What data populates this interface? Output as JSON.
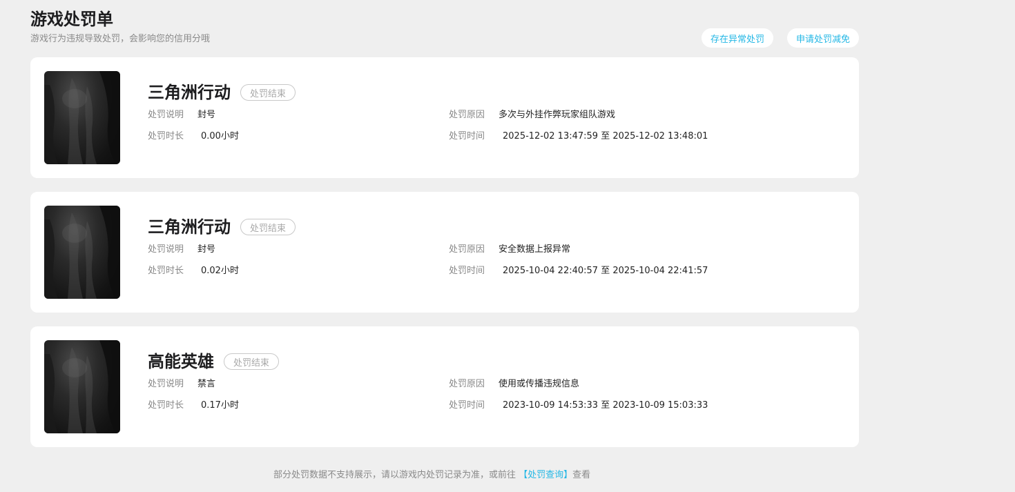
{
  "header": {
    "title": "游戏处罚单",
    "subtitle": "游戏行为违规导致处罚，会影响您的信用分哦",
    "abnormal_button": "存在异常处罚",
    "reduce_button": "申请处罚减免"
  },
  "labels": {
    "description": "处罚说明",
    "reason": "处罚原因",
    "duration": "处罚时长",
    "time": "处罚时间"
  },
  "cards": [
    {
      "game": "三角洲行动",
      "status": "处罚结束",
      "description": "封号",
      "reason": "多次与外挂作弊玩家组队游戏",
      "duration": "0.00小时",
      "time": "2025-12-02 13:47:59 至 2025-12-02 13:48:01"
    },
    {
      "game": "三角洲行动",
      "status": "处罚结束",
      "description": "封号",
      "reason": "安全数据上报异常",
      "duration": "0.02小时",
      "time": "2025-10-04 22:40:57 至 2025-10-04 22:41:57"
    },
    {
      "game": "高能英雄",
      "status": "处罚结束",
      "description": "禁言",
      "reason": "使用或传播违规信息",
      "duration": "0.17小时",
      "time": "2023-10-09 14:53:33 至 2023-10-09 15:03:33"
    }
  ],
  "footer": {
    "text_before": "部分处罚数据不支持展示，请以游戏内处罚记录为准，或前往 ",
    "link": "【处罚查询】",
    "text_after": "查看"
  }
}
